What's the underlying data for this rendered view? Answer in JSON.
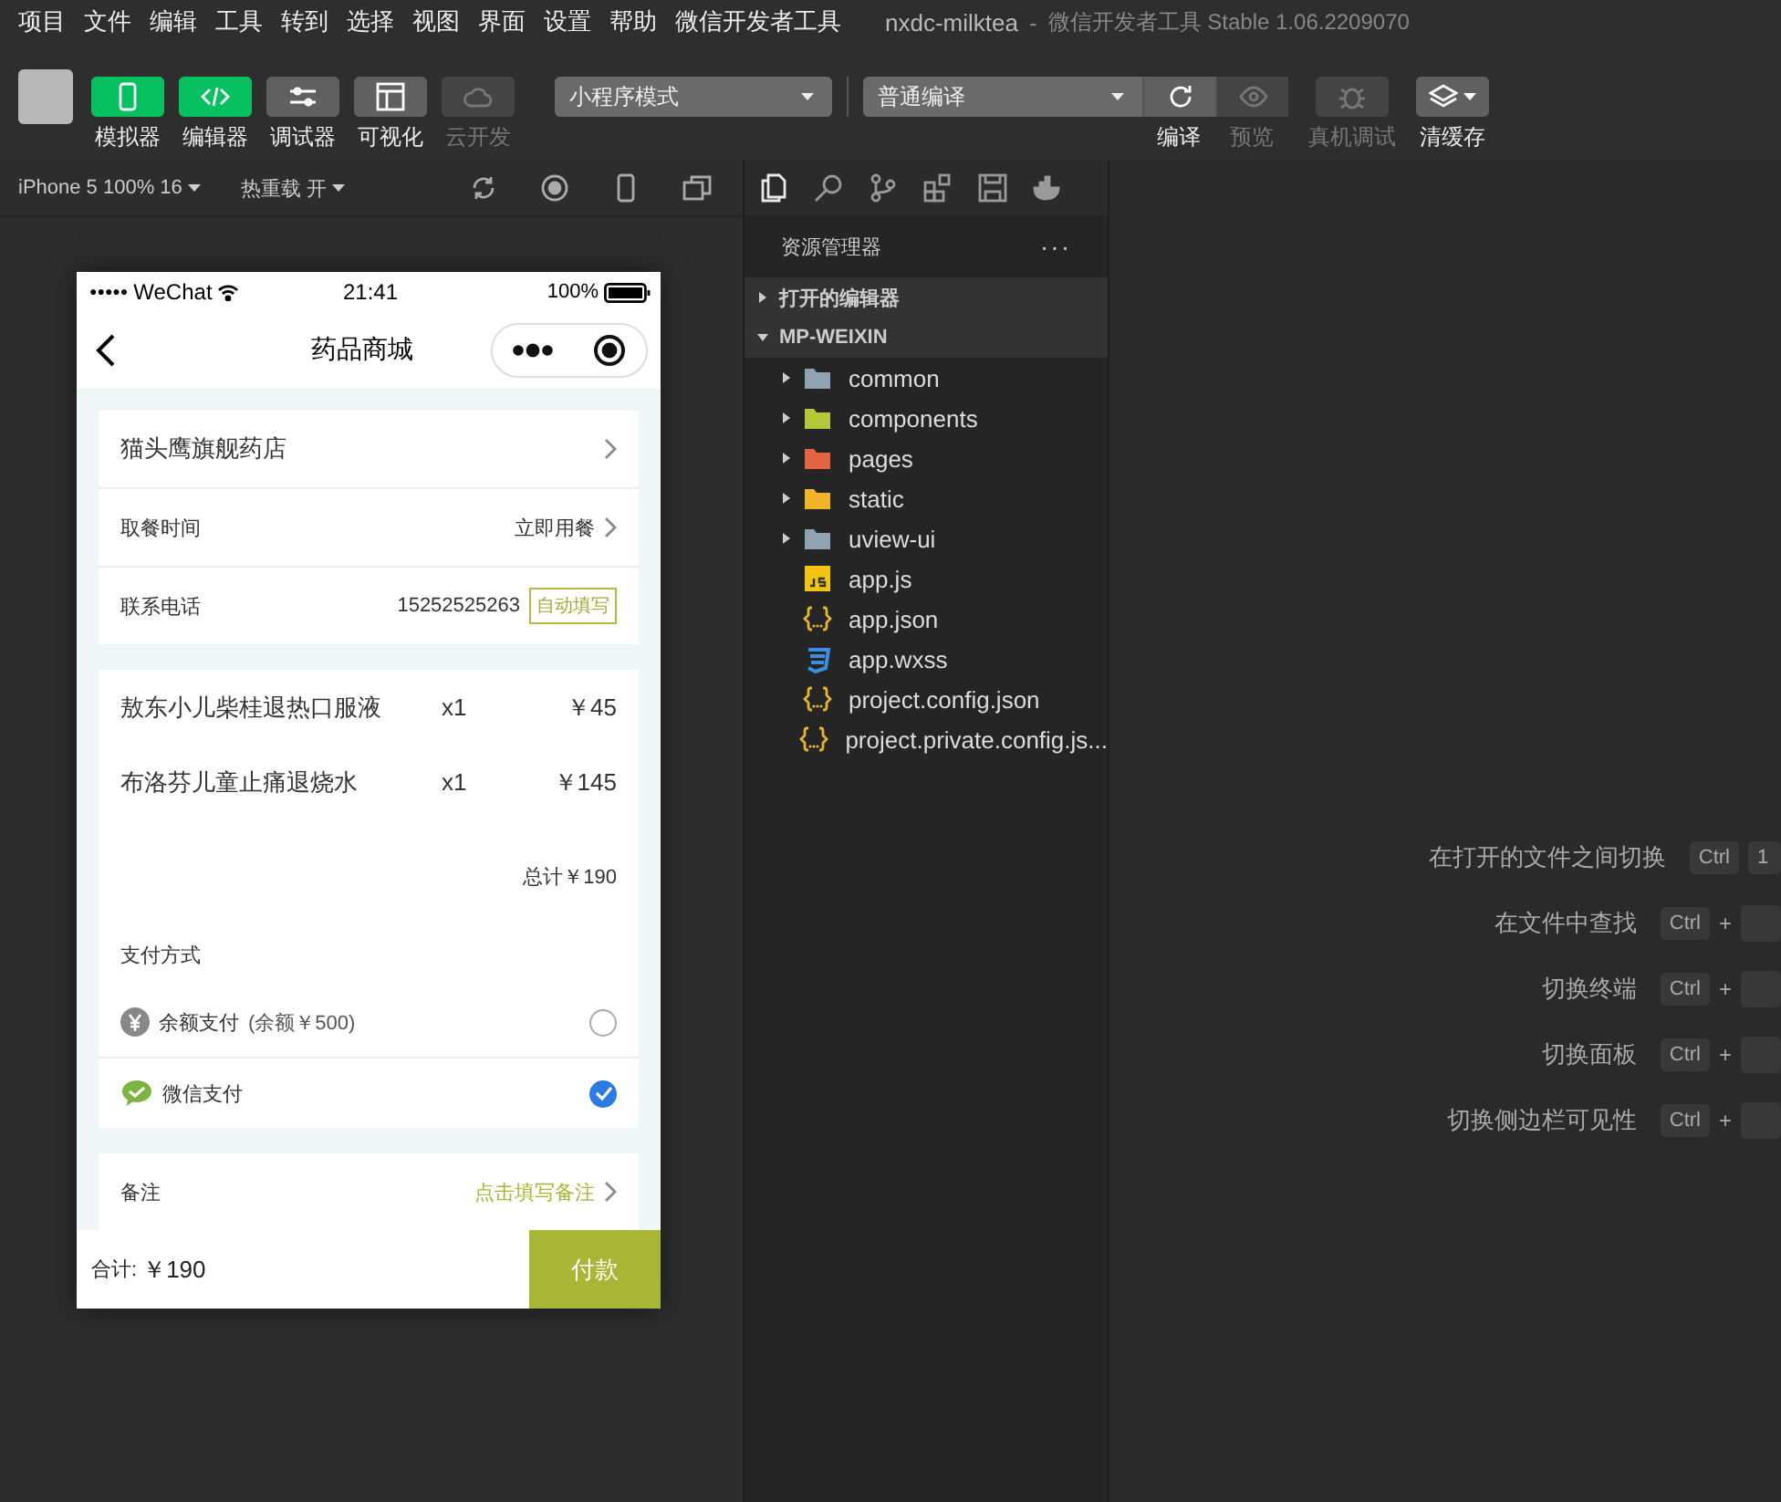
{
  "menu_bar": {
    "items": [
      "项目",
      "文件",
      "编辑",
      "工具",
      "转到",
      "选择",
      "视图",
      "界面",
      "设置",
      "帮助",
      "微信开发者工具"
    ],
    "title": "nxdc-milktea",
    "separator": "-",
    "app_title": "微信开发者工具 Stable 1.06.2209070"
  },
  "toolbar": {
    "left_buttons": [
      {
        "label": "模拟器",
        "selected": true,
        "disabled": false
      },
      {
        "label": "编辑器",
        "selected": true,
        "disabled": false
      },
      {
        "label": "调试器",
        "selected": false,
        "disabled": false
      },
      {
        "label": "可视化",
        "selected": false,
        "disabled": false
      },
      {
        "label": "云开发",
        "selected": false,
        "disabled": true
      }
    ],
    "mode_select": {
      "value": "小程序模式"
    },
    "compile_select": {
      "value": "普通编译"
    },
    "right_buttons": [
      {
        "label": "编译",
        "disabled": false
      },
      {
        "label": "预览",
        "disabled": true
      },
      {
        "label": "真机调试",
        "disabled": true
      },
      {
        "label": "清缓存",
        "disabled": false
      }
    ]
  },
  "simulator_bar": {
    "device": "iPhone 5 100% 16",
    "hot_reload": "热重载 开"
  },
  "activity_icons": [
    {
      "selected": true
    },
    {
      "selected": false
    },
    {
      "selected": false
    },
    {
      "selected": false
    },
    {
      "selected": false
    },
    {
      "selected": false
    }
  ],
  "phone": {
    "status": {
      "signal": "●●●●●",
      "carrier": "WeChat",
      "time": "21:41",
      "battery": "100%"
    },
    "nav_title": "药品商城",
    "shop": {
      "name": "猫头鹰旗舰药店"
    },
    "pickup": {
      "label": "取餐时间",
      "value": "立即用餐"
    },
    "contact": {
      "label": "联系电话",
      "value": "15252525263",
      "action": "自动填写"
    },
    "items": [
      {
        "name": "敖东小儿柴桂退热口服液",
        "qty": "x1",
        "price": "￥45"
      },
      {
        "name": "布洛芬儿童止痛退烧水",
        "qty": "x1",
        "price": "￥145"
      }
    ],
    "total": "总计￥190",
    "payment": {
      "label": "支付方式",
      "options": [
        {
          "kind": "balance",
          "label": "余额支付",
          "note": "(余额￥500)",
          "selected": false
        },
        {
          "kind": "wechat",
          "label": "微信支付",
          "selected": true
        }
      ]
    },
    "remark": {
      "label": "备注",
      "placeholder": "点击填写备注"
    },
    "footer": {
      "label": "合计:",
      "amount": "￥190",
      "button": "付款"
    }
  },
  "explorer": {
    "title": "资源管理器",
    "more": "···",
    "sections": [
      {
        "label": "打开的编辑器",
        "expanded": false
      },
      {
        "label": "MP-WEIXIN",
        "expanded": true
      }
    ],
    "files": [
      {
        "name": "common",
        "kind": "folder",
        "color": "#8fa3b3"
      },
      {
        "name": "components",
        "kind": "folder",
        "color": "#b5c83a"
      },
      {
        "name": "pages",
        "kind": "folder",
        "color": "#e2653f"
      },
      {
        "name": "static",
        "kind": "folder",
        "color": "#f0b429"
      },
      {
        "name": "uview-ui",
        "kind": "folder",
        "color": "#8fa3b3"
      },
      {
        "name": "app.js",
        "kind": "js"
      },
      {
        "name": "app.json",
        "kind": "json"
      },
      {
        "name": "app.wxss",
        "kind": "css"
      },
      {
        "name": "project.config.json",
        "kind": "json"
      },
      {
        "name": "project.private.config.js...",
        "kind": "json"
      }
    ]
  },
  "shortcuts": [
    {
      "label": "在打开的文件之间切换",
      "keys": [
        {
          "kind": "key",
          "text": "Ctrl"
        },
        {
          "kind": "key",
          "text": "1"
        }
      ]
    },
    {
      "label": "在文件中查找",
      "keys": [
        {
          "kind": "key",
          "text": "Ctrl"
        },
        {
          "kind": "plus",
          "text": "+"
        },
        {
          "kind": "cut"
        }
      ]
    },
    {
      "label": "切换终端",
      "keys": [
        {
          "kind": "key",
          "text": "Ctrl"
        },
        {
          "kind": "plus",
          "text": "+"
        },
        {
          "kind": "cut"
        }
      ]
    },
    {
      "label": "切换面板",
      "keys": [
        {
          "kind": "key",
          "text": "Ctrl"
        },
        {
          "kind": "plus",
          "text": "+"
        },
        {
          "kind": "cut"
        }
      ]
    },
    {
      "label": "切换侧边栏可见性",
      "keys": [
        {
          "kind": "key",
          "text": "Ctrl"
        },
        {
          "kind": "plus",
          "text": "+"
        },
        {
          "kind": "cut"
        }
      ]
    }
  ]
}
